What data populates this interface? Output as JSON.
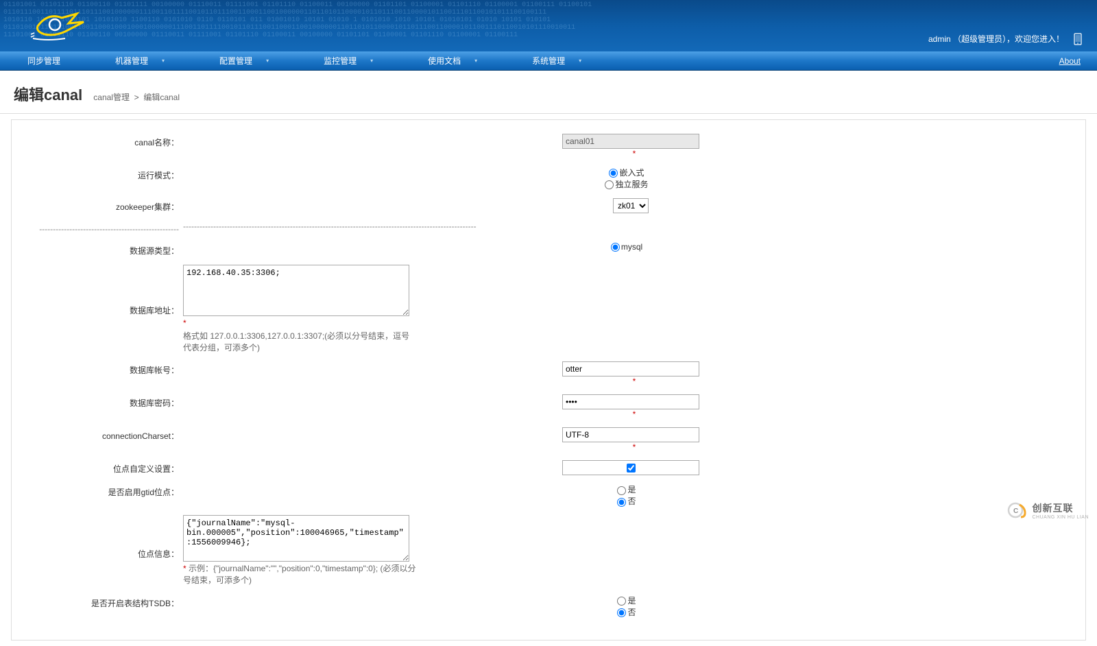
{
  "header": {
    "user_label": "admin （超级管理员），欢迎您进入！"
  },
  "nav": {
    "items": [
      {
        "label": "同步管理",
        "has_chevron": false
      },
      {
        "label": "机器管理",
        "has_chevron": true
      },
      {
        "label": "配置管理",
        "has_chevron": true
      },
      {
        "label": "监控管理",
        "has_chevron": true
      },
      {
        "label": "使用文档",
        "has_chevron": true
      },
      {
        "label": "系统管理",
        "has_chevron": true
      }
    ],
    "about": "About"
  },
  "page": {
    "title": "编辑canal",
    "breadcrumb_parent": "canal管理",
    "breadcrumb_sep": ">",
    "breadcrumb_current": "编辑canal"
  },
  "form": {
    "canal_name": {
      "label": "canal名称：",
      "value": "canal01"
    },
    "run_mode": {
      "label": "运行模式：",
      "opt1": "嵌入式",
      "opt2": "独立服务",
      "selected": "opt1"
    },
    "zk_cluster": {
      "label": "zookeeper集群：",
      "value": "zk01"
    },
    "separator": {
      "label_dashes": "---------------------------------------------------",
      "value_dashes": "-----------------------------------------------------------------------------------------------------------"
    },
    "ds_type": {
      "label": "数据源类型：",
      "opt1": "mysql",
      "selected": "opt1"
    },
    "db_addr": {
      "label": "数据库地址：",
      "value": "192.168.40.35:3306;",
      "help_prefix": "*",
      "help": "格式如 127.0.0.1:3306,127.0.0.1:3307;(必须以分号结束，逗号代表分组，可添多个)"
    },
    "db_user": {
      "label": "数据库帐号：",
      "value": "otter"
    },
    "db_pass": {
      "label": "数据库密码：",
      "value": "••••"
    },
    "conn_charset": {
      "label": "connectionCharset：",
      "value": "UTF-8"
    },
    "pos_custom": {
      "label": "位点自定义设置：",
      "checked": true
    },
    "gtid_enable": {
      "label": "是否启用gtid位点：",
      "opt_yes": "是",
      "opt_no": "否",
      "selected": "no"
    },
    "pos_info": {
      "label": "位点信息：",
      "value": "{\"journalName\":\"mysql-bin.000005\",\"position\":100046965,\"timestamp\":1556009946};",
      "help_prefix": "*",
      "help": " 示例：{\"journalName\":\"\",\"position\":0,\"timestamp\":0}; (必须以分号结束，可添多个)"
    },
    "tsdb_enable": {
      "label": "是否开启表结构TSDB：",
      "opt_yes": "是",
      "opt_no": "否",
      "selected": "no"
    }
  },
  "watermark": {
    "top": "创新互联",
    "bottom": "CHUANG XIN HU LIAN"
  }
}
